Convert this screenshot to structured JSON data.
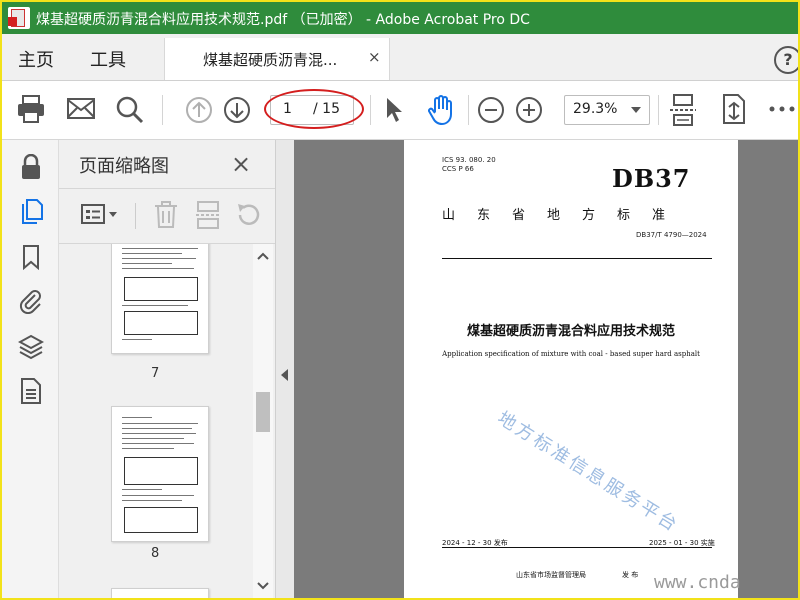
{
  "window": {
    "title": "煤基超硬质沥青混合料应用技术规范.pdf （已加密） - Adobe Acrobat Pro DC",
    "accent": "#2f8c3c"
  },
  "tabs": {
    "home": "主页",
    "tools": "工具",
    "document": "煤基超硬质沥青混...",
    "close": "×",
    "help": "?"
  },
  "toolbar": {
    "icons": [
      "print-icon",
      "email-icon",
      "search-icon",
      "page-up-icon",
      "page-down-icon",
      "select-cursor-icon",
      "hand-tool-icon",
      "zoom-out-icon",
      "zoom-in-icon",
      "fit-page-icon",
      "rotate-icon",
      "more-icon"
    ],
    "page_current": "1",
    "page_total": "/ 15",
    "zoom": "29.3%",
    "highlight_color": "#d41e1e"
  },
  "rail": {
    "icons": [
      "lock-icon",
      "pages-icon",
      "bookmark-icon",
      "attachment-icon",
      "layers-icon",
      "document-properties-icon"
    ],
    "active_color": "#1473e6"
  },
  "thumbnail_panel": {
    "title": "页面缩略图",
    "close": "×",
    "pages": [
      {
        "number": "7"
      },
      {
        "number": "8"
      }
    ]
  },
  "document": {
    "ics": "ICS  93. 080. 20",
    "ccs": "CCS  P  66",
    "db": "DB37",
    "standard_type": "山东省地方标准",
    "code": "DB37/T  4790—2024",
    "title": "煤基超硬质沥青混合料应用技术规范",
    "subtitle": "Application specification of mixture with coal - based super hard asphalt",
    "watermark": "地方标准信息服务平台",
    "issue_date": "2024 - 12 - 30 发布",
    "implement_date": "2025 - 01 - 30 实施",
    "publisher": "山东省市场监督管理局",
    "publish_verb": "发  布"
  },
  "site_watermark": "www.cnda"
}
